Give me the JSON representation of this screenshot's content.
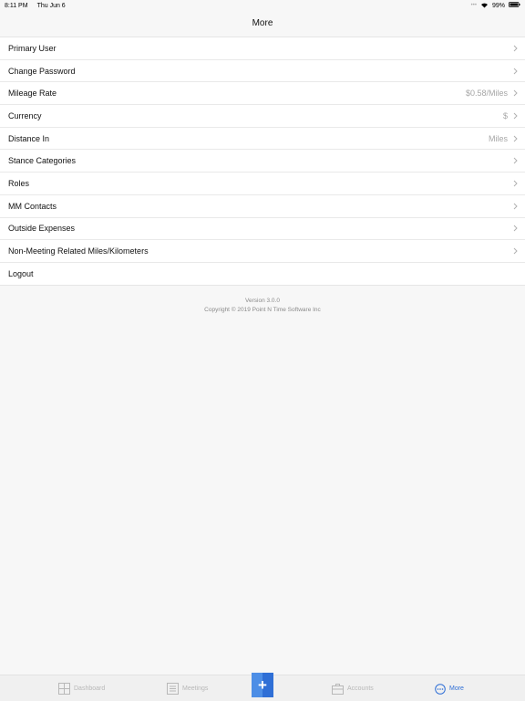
{
  "status_bar": {
    "time": "8:11 PM",
    "date": "Thu Jun 6",
    "battery": "99%"
  },
  "header": {
    "title": "More"
  },
  "menu": {
    "items": [
      {
        "label": "Primary User",
        "value": ""
      },
      {
        "label": "Change Password",
        "value": ""
      },
      {
        "label": "Mileage Rate",
        "value": "$0.58/Miles"
      },
      {
        "label": "Currency",
        "value": "$"
      },
      {
        "label": "Distance In",
        "value": "Miles"
      },
      {
        "label": "Stance Categories",
        "value": ""
      },
      {
        "label": "Roles",
        "value": ""
      },
      {
        "label": "MM Contacts",
        "value": ""
      },
      {
        "label": "Outside Expenses",
        "value": ""
      },
      {
        "label": "Non-Meeting Related Miles/Kilometers",
        "value": ""
      },
      {
        "label": "Logout",
        "value": ""
      }
    ]
  },
  "footer": {
    "version": "Version 3.0.0",
    "copyright": "Copyright © 2019 Point N Time Software Inc"
  },
  "tab_bar": {
    "dashboard": "Dashboard",
    "meetings": "Meetings",
    "add": "+",
    "accounts": "Accounts",
    "more": "More"
  },
  "colors": {
    "accent": "#2f6fd6",
    "inactive": "#b8b8b8",
    "value_text": "#a6a6a6"
  }
}
